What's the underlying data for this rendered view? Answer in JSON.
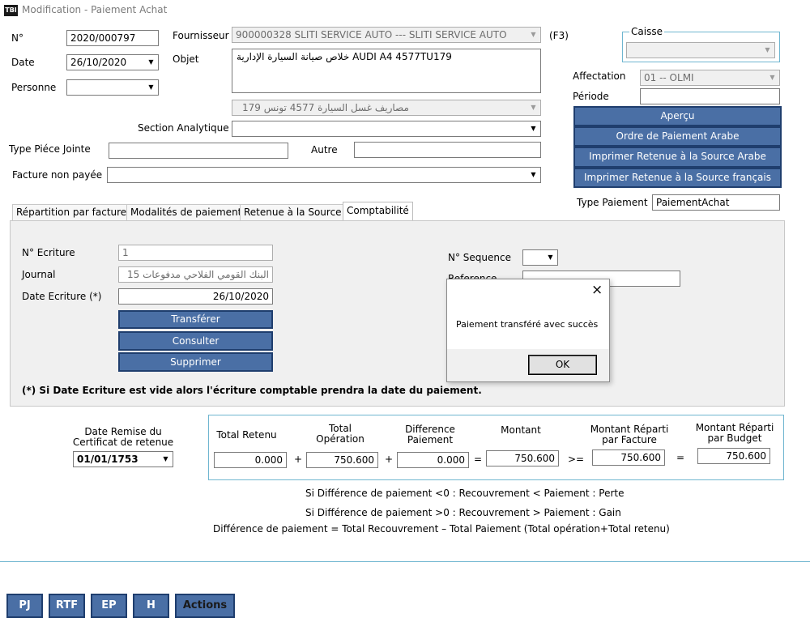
{
  "window": {
    "app_icon": "TBI",
    "title": "Modification - Paiement Achat"
  },
  "header": {
    "num_label": "N°",
    "num_value": "2020/000797",
    "date_label": "Date",
    "date_value": "26/10/2020",
    "personne_label": "Personne",
    "personne_value": "",
    "fournisseur_label": "Fournisseur",
    "fournisseur_value": "900000328 SLITI SERVICE AUTO --- SLITI SERVICE AUTO",
    "f3_label": "(F3)",
    "objet_label": "Objet",
    "objet_value": "خلاص صيانة السيارة الإدارية AUDI A4 4577TU179",
    "objet_combo_value": "مصاريف غسل السيارة 4577 تونس 179",
    "section_label": "Section Analytique",
    "section_value": "",
    "type_piece_label": "Type Piéce Jointe",
    "type_piece_value": "",
    "autre_label": "Autre",
    "autre_value": "",
    "facture_label": "Facture non payée",
    "facture_value": ""
  },
  "right": {
    "caisse_label": "Caisse",
    "caisse_value": "",
    "affectation_label": "Affectation",
    "affectation_value": "01 -- OLMI",
    "periode_label": "Période",
    "periode_value": "",
    "apercu_btn": "Aperçu",
    "ordre_btn": "Ordre de Paiement Arabe",
    "retenue_arabe_btn": "Imprimer Retenue à la Source Arabe",
    "retenue_fr_btn": "Imprimer Retenue à la Source français",
    "type_paiement_label": "Type Paiement",
    "type_paiement_value": "PaiementAchat"
  },
  "tabs": [
    {
      "label": "Répartition par facture"
    },
    {
      "label": "Modalités de paiement"
    },
    {
      "label": "Retenue à la Source"
    },
    {
      "label": "Comptabilité"
    }
  ],
  "compta": {
    "ecriture_label": "N° Ecriture",
    "ecriture_value": "1",
    "journal_label": "Journal",
    "journal_value": "البنك القومي الفلاحي مدفوعات  15",
    "date_ecriture_label": "Date Ecriture (*)",
    "date_ecriture_value": "26/10/2020",
    "transferer_btn": "Transférer",
    "consulter_btn": "Consulter",
    "supprimer_btn": "Supprimer",
    "sequence_label": "N° Sequence",
    "sequence_value": "",
    "reference_label": "Reference",
    "reference_value": "",
    "note": "(*) Si Date Ecriture est vide alors l'écriture comptable prendra la date du paiement."
  },
  "dialog": {
    "message": "Paiement transféré avec succès",
    "ok": "OK",
    "close": "×"
  },
  "totals": {
    "date_remise_label": "Date Remise du Certificat de retenue",
    "date_remise_value": "01/01/1753",
    "total_retenu_label": "Total Retenu",
    "total_retenu_value": "0.000",
    "total_operation_label": "Total Opération",
    "total_operation_value": "750.600",
    "difference_label": "Difference Paiement",
    "difference_value": "0.000",
    "montant_label": "Montant",
    "montant_value": "750.600",
    "montant_facture_label": "Montant Réparti par Facture",
    "montant_facture_value": "750.600",
    "montant_budget_label": "Montant Réparti par Budget",
    "montant_budget_value": "750.600",
    "op_plus1": "+",
    "op_plus2": "+",
    "op_eq1": "=",
    "op_ge": ">=",
    "op_eq2": "="
  },
  "notes": {
    "line1": "Si Différence de paiement <0 : Recouvrement < Paiement : Perte",
    "line2": "Si Différence de paiement >0 : Recouvrement > Paiement : Gain",
    "line3": "Différence de paiement = Total Recouvrement – Total Paiement (Total opération+Total retenu)"
  },
  "bottom": {
    "pj": "PJ",
    "rtf": "RTF",
    "ep": "EP",
    "h": "H",
    "actions": "Actions"
  },
  "colors": {
    "button_blue": "#4a6fa5",
    "button_border": "#1f3e6e",
    "panel_bg": "#f0f0f0",
    "group_border": "#6fb6d0"
  }
}
